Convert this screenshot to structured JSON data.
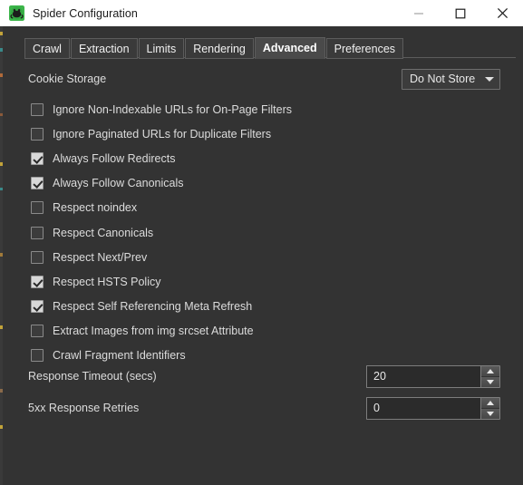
{
  "window": {
    "title": "Spider Configuration",
    "app_icon": "screaming-frog-icon",
    "controls": {
      "minimize": "minimize-icon",
      "maximize": "maximize-icon",
      "close": "close-icon"
    }
  },
  "tabs": [
    {
      "label": "Crawl",
      "selected": false
    },
    {
      "label": "Extraction",
      "selected": false
    },
    {
      "label": "Limits",
      "selected": false
    },
    {
      "label": "Rendering",
      "selected": false
    },
    {
      "label": "Advanced",
      "selected": true
    },
    {
      "label": "Preferences",
      "selected": false
    }
  ],
  "cookie_storage": {
    "label": "Cookie Storage",
    "value": "Do Not Store",
    "arrow": "chevron-down-icon"
  },
  "checkboxes": [
    {
      "label": "Ignore Non-Indexable URLs for On-Page Filters",
      "checked": false
    },
    {
      "label": "Ignore Paginated URLs for Duplicate Filters",
      "checked": false
    },
    {
      "label": "Always Follow Redirects",
      "checked": true
    },
    {
      "label": "Always Follow Canonicals",
      "checked": true
    },
    {
      "label": "Respect noindex",
      "checked": false
    },
    {
      "label": "Respect Canonicals",
      "checked": false
    },
    {
      "label": "Respect Next/Prev",
      "checked": false
    },
    {
      "label": "Respect HSTS Policy",
      "checked": true
    },
    {
      "label": "Respect Self Referencing Meta Refresh",
      "checked": true
    },
    {
      "label": "Extract Images from img srcset Attribute",
      "checked": false
    },
    {
      "label": "Crawl Fragment Identifiers",
      "checked": false
    }
  ],
  "spinners": [
    {
      "label": "Response Timeout (secs)",
      "value": "20"
    },
    {
      "label": "5xx Response Retries",
      "value": "0"
    }
  ],
  "colors": {
    "window_bg": "#333333",
    "titlebar_bg": "#ffffff",
    "text": "#dcdcdc",
    "tab_selected_bg": "#4a4a4a",
    "field_bg": "#2b2b2b",
    "border": "#7d7d7d",
    "accent_icon_green": "#39b54a"
  }
}
